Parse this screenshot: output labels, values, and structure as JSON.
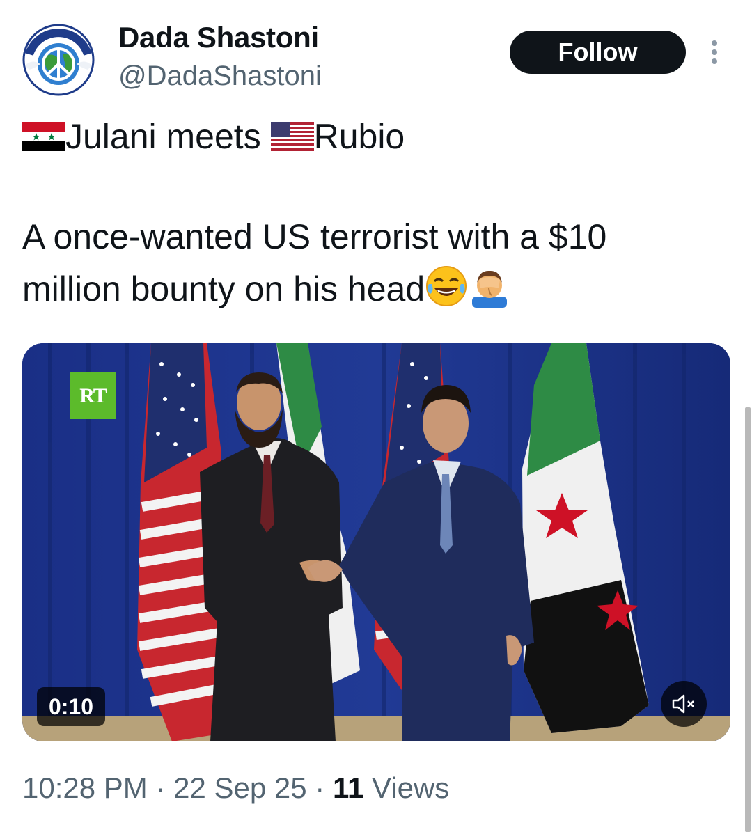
{
  "author": {
    "name": "Dada Shastoni",
    "handle": "@DadaShastoni",
    "avatar_icon": "peace-globe-avatar-icon"
  },
  "follow_label": "Follow",
  "more_icon": "more-vertical-icon",
  "tweet": {
    "line1_a": "Julani meets ",
    "line1_b": "Rubio",
    "line2": "A once-wanted US terrorist with a $10",
    "line3": "million bounty on his head",
    "flags": [
      "syria-flag-icon",
      "usa-flag-icon"
    ],
    "emojis": [
      "tears-of-joy-emoji-icon",
      "facepalm-emoji-icon"
    ]
  },
  "media": {
    "watermark": "RT",
    "duration": "0:10",
    "mute_icon": "speaker-muted-icon"
  },
  "meta": {
    "time": "10:28 PM",
    "sep1": " · ",
    "date": "22 Sep 25",
    "sep2": " · ",
    "views_count": "11",
    "views_label": " Views"
  },
  "colors": {
    "text": "#0f1419",
    "secondary": "#536471",
    "follow_bg": "#0f1419",
    "rt_green": "#5cbb2b"
  }
}
